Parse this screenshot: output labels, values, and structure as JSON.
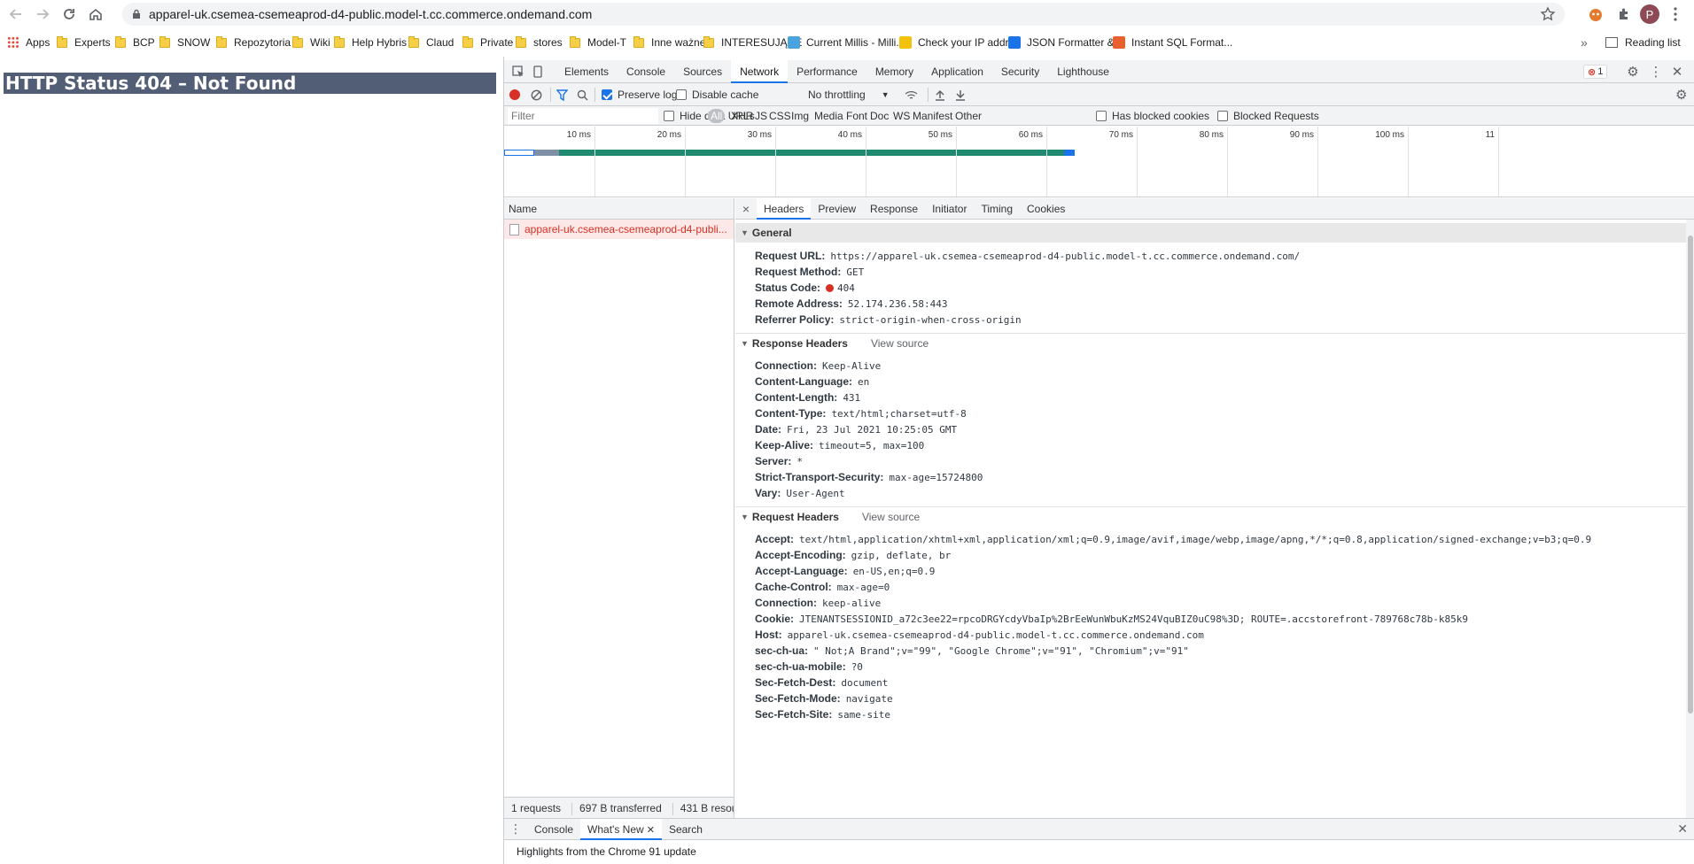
{
  "browser": {
    "url": "apparel-uk.csemea-csemeaprod-d4-public.model-t.cc.commerce.ondemand.com",
    "avatar_letter": "P",
    "bookmarks": [
      {
        "label": "Apps",
        "icon": "apps-grid-icon"
      },
      {
        "label": "Experts",
        "icon": "folder-icon"
      },
      {
        "label": "BCP",
        "icon": "folder-icon"
      },
      {
        "label": "SNOW",
        "icon": "folder-icon"
      },
      {
        "label": "Repozytoria",
        "icon": "folder-icon"
      },
      {
        "label": "Wiki",
        "icon": "folder-icon"
      },
      {
        "label": "Help Hybris",
        "icon": "folder-icon"
      },
      {
        "label": "Claud",
        "icon": "folder-icon"
      },
      {
        "label": "Private",
        "icon": "folder-icon"
      },
      {
        "label": "stores",
        "icon": "folder-icon"
      },
      {
        "label": "Model-T",
        "icon": "folder-icon"
      },
      {
        "label": "Inne ważne",
        "icon": "folder-icon"
      },
      {
        "label": "INTERESUJĄCE",
        "icon": "folder-icon"
      },
      {
        "label": "Current Millis - Milli...",
        "icon": "millis-icon"
      },
      {
        "label": "Check your IP addr...",
        "icon": "ip-icon"
      },
      {
        "label": "JSON Formatter &...",
        "icon": "json-check-icon"
      },
      {
        "label": "Instant SQL Format...",
        "icon": "sql-icon"
      }
    ],
    "bookmarks_more": "»",
    "reading_list": "Reading list"
  },
  "page": {
    "heading": "HTTP Status 404 – Not Found"
  },
  "devtools": {
    "tabs": [
      "Elements",
      "Console",
      "Sources",
      "Network",
      "Performance",
      "Memory",
      "Application",
      "Security",
      "Lighthouse"
    ],
    "selected_tab": "Network",
    "error_count": "1",
    "toolbar": {
      "preserve_log": "Preserve log",
      "disable_cache": "Disable cache",
      "throttling": "No throttling"
    },
    "filter": {
      "placeholder": "Filter",
      "hide_data_urls": "Hide data URLs",
      "types": [
        "All",
        "XHR",
        "JS",
        "CSS",
        "Img",
        "Media",
        "Font",
        "Doc",
        "WS",
        "Manifest",
        "Other"
      ],
      "has_blocked_cookies": "Has blocked cookies",
      "blocked_requests": "Blocked Requests"
    },
    "overview_ticks": [
      "10 ms",
      "20 ms",
      "30 ms",
      "40 ms",
      "50 ms",
      "60 ms",
      "70 ms",
      "80 ms",
      "90 ms",
      "100 ms",
      "11"
    ],
    "name_header": "Name",
    "request_name": "apparel-uk.csemea-csemeaprod-d4-publi...",
    "status_bar": {
      "requests": "1 requests",
      "transferred": "697 B transferred",
      "resources": "431 B resou"
    },
    "detail_tabs": [
      "Headers",
      "Preview",
      "Response",
      "Initiator",
      "Timing",
      "Cookies"
    ],
    "general": {
      "title": "General",
      "rows": [
        {
          "k": "Request URL:",
          "v": "https://apparel-uk.csemea-csemeaprod-d4-public.model-t.cc.commerce.ondemand.com/"
        },
        {
          "k": "Request Method:",
          "v": "GET"
        },
        {
          "k": "Status Code:",
          "v": "404"
        },
        {
          "k": "Remote Address:",
          "v": "52.174.236.58:443"
        },
        {
          "k": "Referrer Policy:",
          "v": "strict-origin-when-cross-origin"
        }
      ]
    },
    "response_headers": {
      "title": "Response Headers",
      "view_source": "View source",
      "rows": [
        {
          "k": "Connection:",
          "v": "Keep-Alive"
        },
        {
          "k": "Content-Language:",
          "v": "en"
        },
        {
          "k": "Content-Length:",
          "v": "431"
        },
        {
          "k": "Content-Type:",
          "v": "text/html;charset=utf-8"
        },
        {
          "k": "Date:",
          "v": "Fri, 23 Jul 2021 10:25:05 GMT"
        },
        {
          "k": "Keep-Alive:",
          "v": "timeout=5, max=100"
        },
        {
          "k": "Server:",
          "v": "*"
        },
        {
          "k": "Strict-Transport-Security:",
          "v": "max-age=15724800"
        },
        {
          "k": "Vary:",
          "v": "User-Agent"
        }
      ]
    },
    "request_headers": {
      "title": "Request Headers",
      "view_source": "View source",
      "rows": [
        {
          "k": "Accept:",
          "v": "text/html,application/xhtml+xml,application/xml;q=0.9,image/avif,image/webp,image/apng,*/*;q=0.8,application/signed-exchange;v=b3;q=0.9"
        },
        {
          "k": "Accept-Encoding:",
          "v": "gzip, deflate, br"
        },
        {
          "k": "Accept-Language:",
          "v": "en-US,en;q=0.9"
        },
        {
          "k": "Cache-Control:",
          "v": "max-age=0"
        },
        {
          "k": "Connection:",
          "v": "keep-alive"
        },
        {
          "k": "Cookie:",
          "v": "JTENANTSESSIONID_a72c3ee22=rpcoDRGYcdyVbaIp%2BrEeWunWbuKzMS24VquBIZ0uC98%3D; ROUTE=.accstorefront-789768c78b-k85k9"
        },
        {
          "k": "Host:",
          "v": "apparel-uk.csemea-csemeaprod-d4-public.model-t.cc.commerce.ondemand.com"
        },
        {
          "k": "sec-ch-ua:",
          "v": "\" Not;A Brand\";v=\"99\", \"Google Chrome\";v=\"91\", \"Chromium\";v=\"91\""
        },
        {
          "k": "sec-ch-ua-mobile:",
          "v": "?0"
        },
        {
          "k": "Sec-Fetch-Dest:",
          "v": "document"
        },
        {
          "k": "Sec-Fetch-Mode:",
          "v": "navigate"
        },
        {
          "k": "Sec-Fetch-Site:",
          "v": "same-site"
        }
      ]
    },
    "drawer": {
      "tabs": [
        "Console",
        "What's New",
        "Search"
      ],
      "selected": "What's New",
      "body": "Highlights from the Chrome 91 update"
    }
  }
}
